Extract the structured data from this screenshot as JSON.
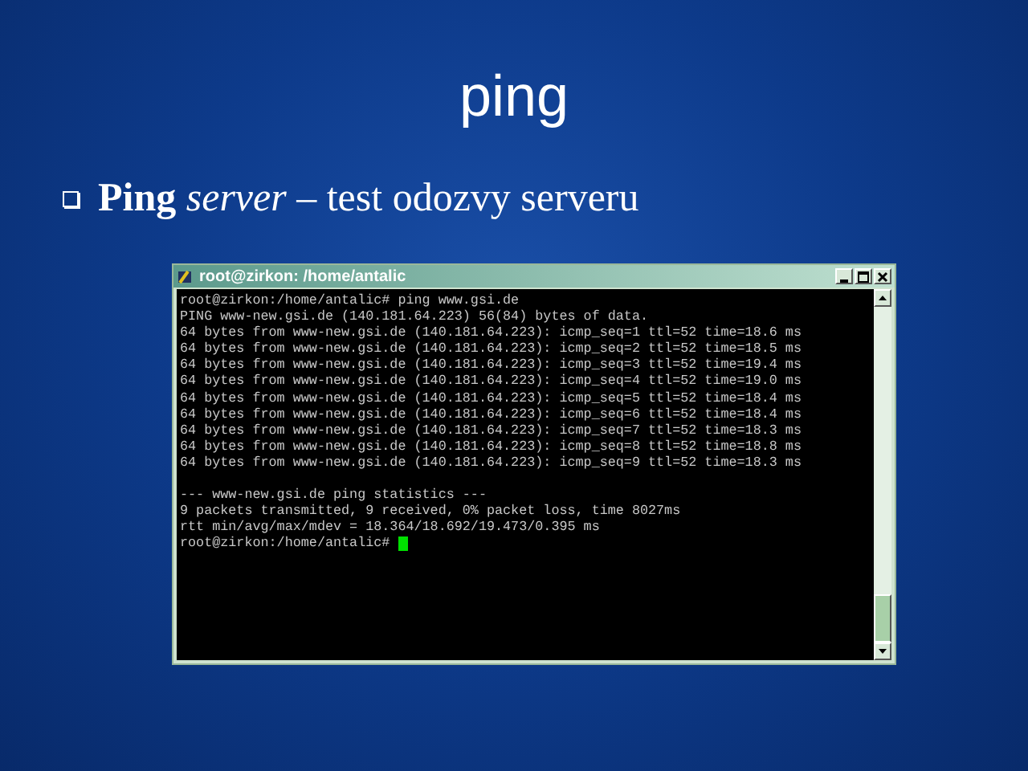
{
  "slide": {
    "title": "ping",
    "bullets": [
      {
        "text": "**Ping** *server* – test odozvy serveru"
      }
    ]
  },
  "terminal": {
    "title": "root@zirkon: /home/antalic",
    "output": [
      "root@zirkon:/home/antalic# ping www.gsi.de",
      "PING www-new.gsi.de (140.181.64.223) 56(84) bytes of data.",
      "64 bytes from www-new.gsi.de (140.181.64.223): icmp_seq=1 ttl=52 time=18.6 ms",
      "64 bytes from www-new.gsi.de (140.181.64.223): icmp_seq=2 ttl=52 time=18.5 ms",
      "64 bytes from www-new.gsi.de (140.181.64.223): icmp_seq=3 ttl=52 time=19.4 ms",
      "64 bytes from www-new.gsi.de (140.181.64.223): icmp_seq=4 ttl=52 time=19.0 ms",
      "64 bytes from www-new.gsi.de (140.181.64.223): icmp_seq=5 ttl=52 time=18.4 ms",
      "64 bytes from www-new.gsi.de (140.181.64.223): icmp_seq=6 ttl=52 time=18.4 ms",
      "64 bytes from www-new.gsi.de (140.181.64.223): icmp_seq=7 ttl=52 time=18.3 ms",
      "64 bytes from www-new.gsi.de (140.181.64.223): icmp_seq=8 ttl=52 time=18.8 ms",
      "64 bytes from www-new.gsi.de (140.181.64.223): icmp_seq=9 ttl=52 time=18.3 ms"
    ],
    "statistics": [
      "--- www-new.gsi.de ping statistics ---",
      "9 packets transmitted, 9 received, 0% packet loss, time 8027ms",
      "rtt min/avg/max/mdev = 18.364/18.692/19.473/0.395 ms"
    ],
    "prompt": "root@zirkon:/home/antalic#"
  }
}
